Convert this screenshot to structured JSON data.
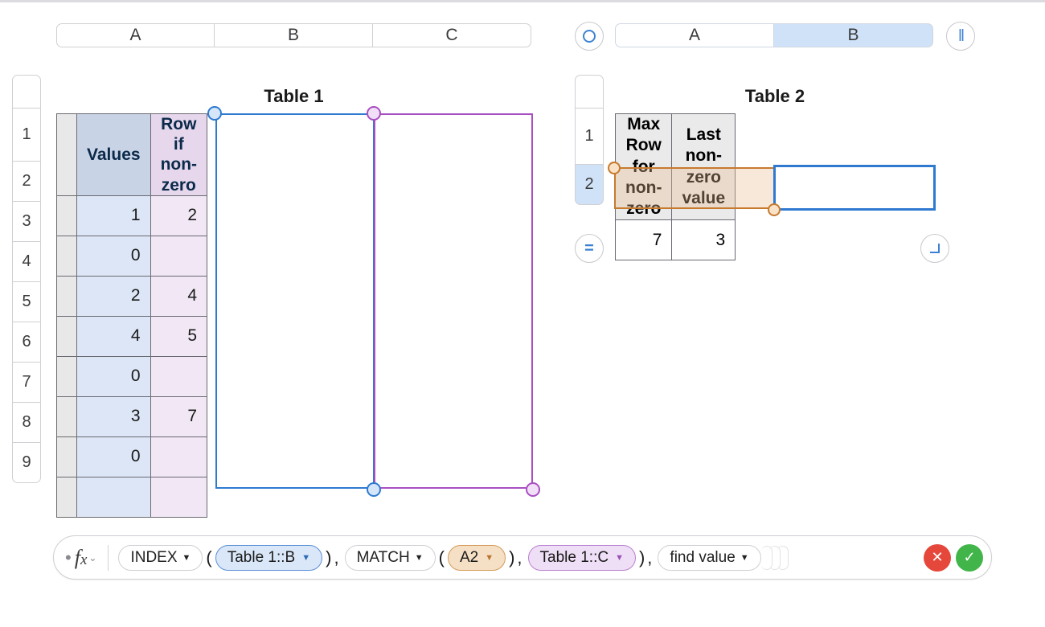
{
  "table1": {
    "title": "Table 1",
    "col_tabs": [
      "A",
      "B",
      "C"
    ],
    "row_labels": [
      "1",
      "2",
      "3",
      "4",
      "5",
      "6",
      "7",
      "8",
      "9"
    ],
    "headers": {
      "B": "Values",
      "C": "Row if non-zero"
    },
    "rows": [
      {
        "B": "1",
        "C": "2"
      },
      {
        "B": "0",
        "C": ""
      },
      {
        "B": "2",
        "C": "4"
      },
      {
        "B": "4",
        "C": "5"
      },
      {
        "B": "0",
        "C": ""
      },
      {
        "B": "3",
        "C": "7"
      },
      {
        "B": "0",
        "C": ""
      },
      {
        "B": "",
        "C": ""
      }
    ]
  },
  "table2": {
    "title": "Table 2",
    "col_tabs": [
      "A",
      "B"
    ],
    "row_labels": [
      "1",
      "2"
    ],
    "headers": {
      "A": "Max Row for non-zero",
      "B": "Last non-zero value"
    },
    "values": {
      "A": "7",
      "B": "3"
    }
  },
  "formula_bar": {
    "fn1": "INDEX",
    "ref1": "Table 1::B",
    "fn2": "MATCH",
    "ref2": "A2",
    "ref3": "Table 1::C",
    "ref4": "find value",
    "sep": ","
  }
}
